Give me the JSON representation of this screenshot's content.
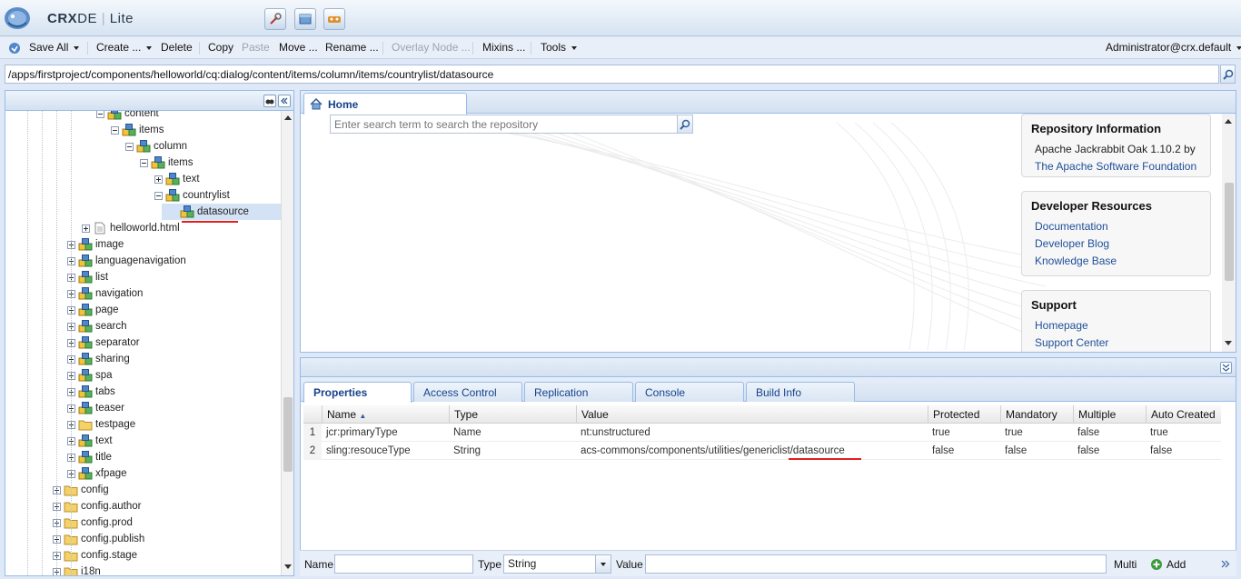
{
  "header": {
    "brand_bold": "CRX",
    "brand_rest": "DE",
    "brand_suffix": "Lite"
  },
  "toolbar": {
    "save_all": "Save All",
    "create": "Create ...",
    "delete": "Delete",
    "copy": "Copy",
    "paste": "Paste",
    "move": "Move ...",
    "rename": "Rename ...",
    "overlay_node": "Overlay Node ...",
    "mixins": "Mixins ...",
    "tools": "Tools",
    "user": "Administrator@crx.default"
  },
  "path": "/apps/firstproject/components/helloworld/cq:dialog/content/items/column/items/countrylist/datasource",
  "tree": {
    "items": [
      {
        "label": "content",
        "depth": 6,
        "icon": "node",
        "expanded": true
      },
      {
        "label": "items",
        "depth": 7,
        "icon": "node",
        "expanded": true
      },
      {
        "label": "column",
        "depth": 8,
        "icon": "node",
        "expanded": true
      },
      {
        "label": "items",
        "depth": 9,
        "icon": "node",
        "expanded": true
      },
      {
        "label": "text",
        "depth": 10,
        "icon": "node",
        "expanded": false
      },
      {
        "label": "countrylist",
        "depth": 10,
        "icon": "node",
        "expanded": true
      },
      {
        "label": "datasource",
        "depth": 11,
        "icon": "node",
        "expanded": null,
        "selected": true
      },
      {
        "label": "helloworld.html",
        "depth": 5,
        "icon": "file",
        "expanded": false
      },
      {
        "label": "image",
        "depth": 4,
        "icon": "node",
        "expanded": false
      },
      {
        "label": "languagenavigation",
        "depth": 4,
        "icon": "node",
        "expanded": false
      },
      {
        "label": "list",
        "depth": 4,
        "icon": "node",
        "expanded": false
      },
      {
        "label": "navigation",
        "depth": 4,
        "icon": "node",
        "expanded": false
      },
      {
        "label": "page",
        "depth": 4,
        "icon": "node",
        "expanded": false
      },
      {
        "label": "search",
        "depth": 4,
        "icon": "node",
        "expanded": false
      },
      {
        "label": "separator",
        "depth": 4,
        "icon": "node",
        "expanded": false
      },
      {
        "label": "sharing",
        "depth": 4,
        "icon": "node",
        "expanded": false
      },
      {
        "label": "spa",
        "depth": 4,
        "icon": "node",
        "expanded": false
      },
      {
        "label": "tabs",
        "depth": 4,
        "icon": "node",
        "expanded": false
      },
      {
        "label": "teaser",
        "depth": 4,
        "icon": "node",
        "expanded": false
      },
      {
        "label": "testpage",
        "depth": 4,
        "icon": "folder",
        "expanded": false
      },
      {
        "label": "text",
        "depth": 4,
        "icon": "node",
        "expanded": false
      },
      {
        "label": "title",
        "depth": 4,
        "icon": "node",
        "expanded": false
      },
      {
        "label": "xfpage",
        "depth": 4,
        "icon": "node",
        "expanded": false
      },
      {
        "label": "config",
        "depth": 3,
        "icon": "folder",
        "expanded": false
      },
      {
        "label": "config.author",
        "depth": 3,
        "icon": "folder",
        "expanded": false
      },
      {
        "label": "config.prod",
        "depth": 3,
        "icon": "folder",
        "expanded": false
      },
      {
        "label": "config.publish",
        "depth": 3,
        "icon": "folder",
        "expanded": false
      },
      {
        "label": "config.stage",
        "depth": 3,
        "icon": "folder",
        "expanded": false
      },
      {
        "label": "i18n",
        "depth": 3,
        "icon": "folder",
        "expanded": false
      }
    ]
  },
  "main": {
    "home_tab": "Home",
    "search_placeholder": "Enter search term to search the repository",
    "repo_info": {
      "title": "Repository Information",
      "line1": "Apache Jackrabbit Oak 1.10.2 by",
      "link": "The Apache Software Foundation"
    },
    "dev_resources": {
      "title": "Developer Resources",
      "links": [
        "Documentation",
        "Developer Blog",
        "Knowledge Base"
      ]
    },
    "support": {
      "title": "Support",
      "links": [
        "Homepage",
        "Support Center"
      ]
    }
  },
  "props": {
    "tabs": [
      "Properties",
      "Access Control",
      "Replication",
      "Console",
      "Build Info"
    ],
    "columns": [
      "Name",
      "Type",
      "Value",
      "Protected",
      "Mandatory",
      "Multiple",
      "Auto Created"
    ],
    "rows": [
      {
        "num": "1",
        "name": "jcr:primaryType",
        "type": "Name",
        "value": "nt:unstructured",
        "protected": "true",
        "mandatory": "true",
        "multiple": "false",
        "auto": "true"
      },
      {
        "num": "2",
        "name": "sling:resouceType",
        "type": "String",
        "value": "acs-commons/components/utilities/genericlist/datasource",
        "protected": "false",
        "mandatory": "false",
        "multiple": "false",
        "auto": "false"
      }
    ]
  },
  "addbar": {
    "name_label": "Name",
    "type_label": "Type",
    "type_value": "String",
    "value_label": "Value",
    "multi_label": "Multi",
    "add_label": "Add"
  },
  "colors": {
    "accent_underline": "#e02020",
    "panel_border": "#99bbe8",
    "tab_text": "#15428b"
  }
}
